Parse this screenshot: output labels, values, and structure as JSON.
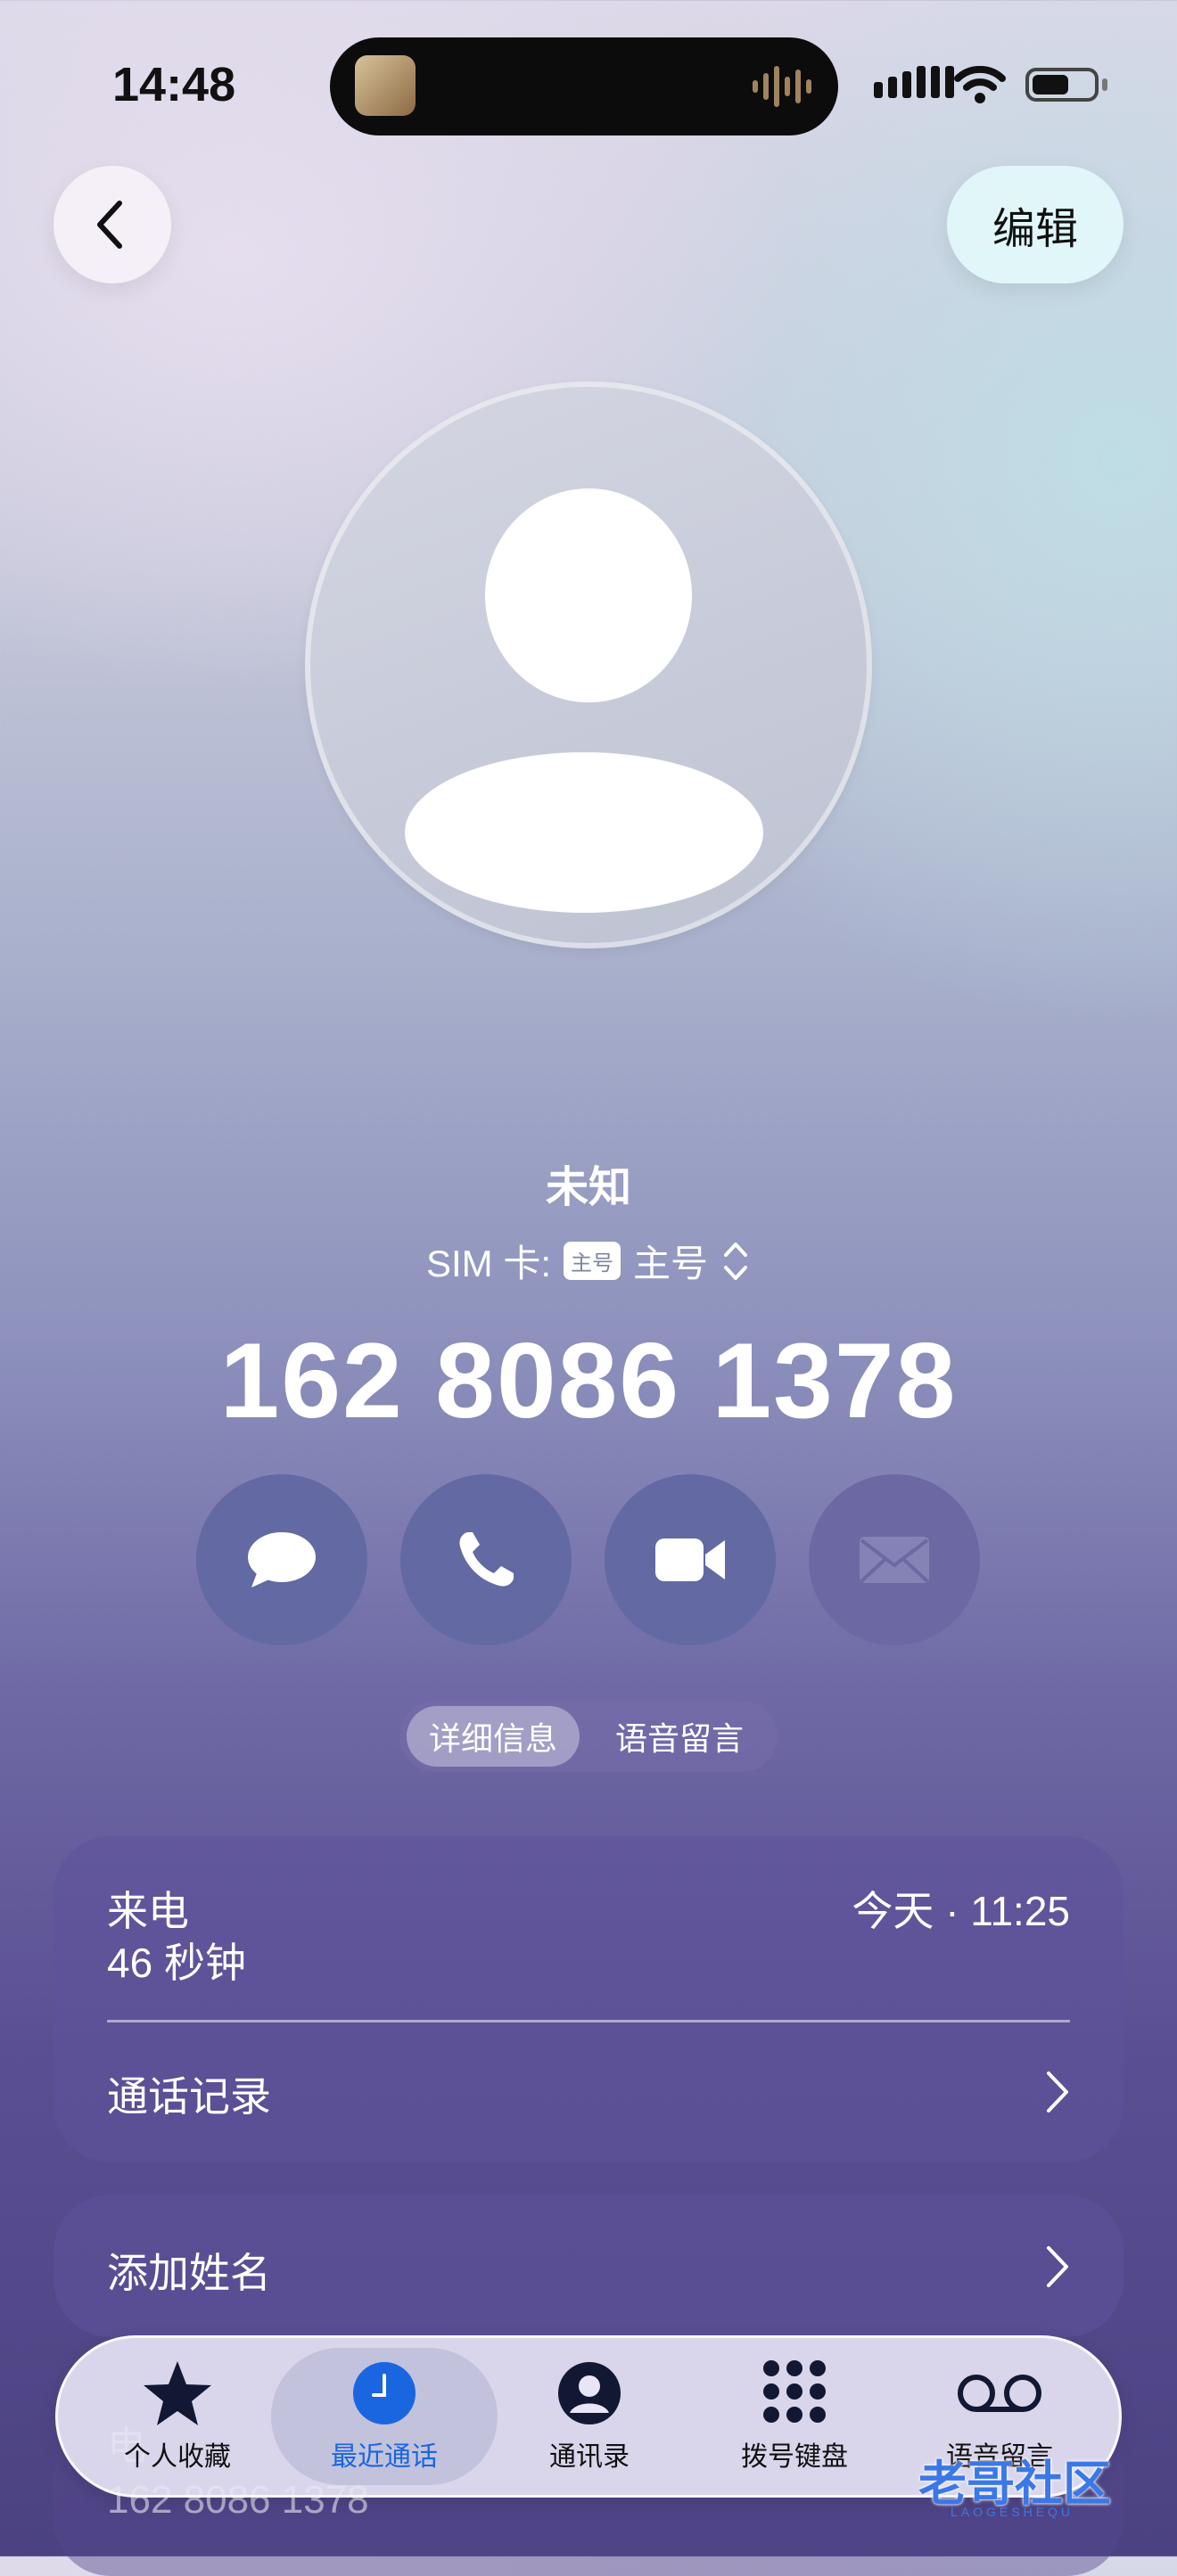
{
  "status_bar": {
    "time": "14:48"
  },
  "nav": {
    "edit_label": "编辑"
  },
  "contact": {
    "name": "未知",
    "sim_prefix": "SIM 卡:",
    "sim_badge": "主号",
    "sim_line": "主号",
    "phone_number": "162 8086 1378"
  },
  "actions": [
    "message-icon",
    "phone-icon",
    "video-icon",
    "mail-icon"
  ],
  "segment": {
    "active": "详细信息",
    "inactive": "语音留言"
  },
  "call_card": {
    "type_label": "来电",
    "duration": "46 秒钟",
    "time": "今天 · 11:25",
    "history_label": "通话记录"
  },
  "add_name_label": "添加姓名",
  "phone_card": {
    "label": "电",
    "number": "162 8086 1378"
  },
  "tabbar": {
    "items": [
      {
        "label": "个人收藏",
        "icon": "star-icon"
      },
      {
        "label": "最近通话",
        "icon": "clock-icon"
      },
      {
        "label": "通讯录",
        "icon": "person-icon"
      },
      {
        "label": "拨号键盘",
        "icon": "keypad-icon"
      },
      {
        "label": "语音留言",
        "icon": "voicemail-icon"
      }
    ],
    "active_index": 1
  },
  "watermark": {
    "text": "老哥社区",
    "sub": "LAOGESHEQU"
  },
  "colors": {
    "accent": "#1a66e0",
    "action_bg": "#6369a3"
  }
}
